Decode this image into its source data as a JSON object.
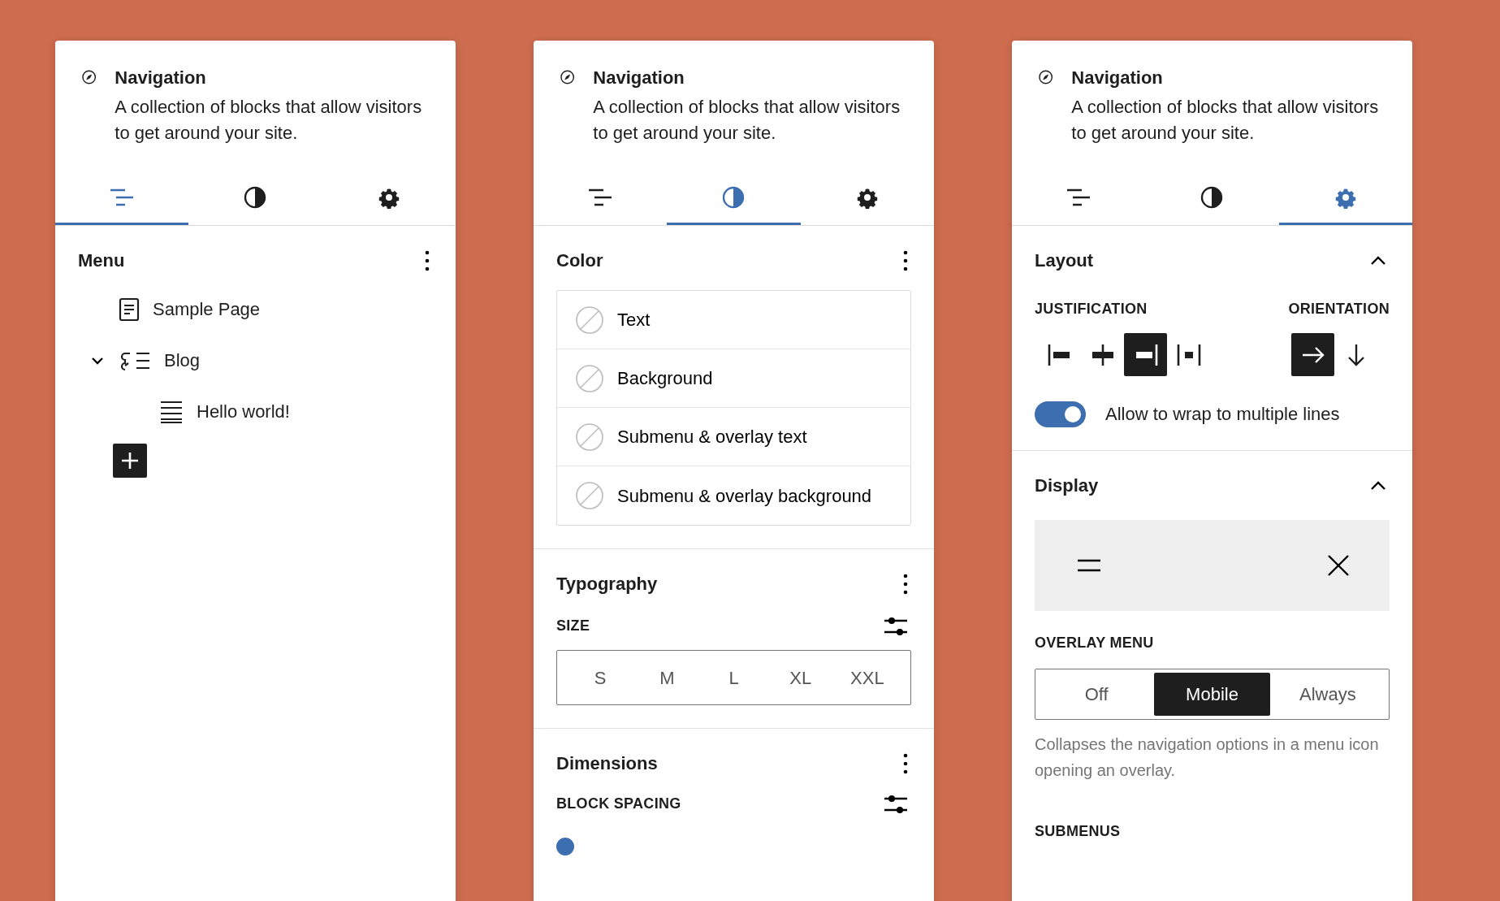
{
  "panels": [
    {
      "block": {
        "title": "Navigation",
        "description": "A collection of blocks that allow visitors to get around your site."
      },
      "tabs": [
        {
          "kind": "list",
          "selected": true
        },
        {
          "kind": "styles",
          "selected": false
        },
        {
          "kind": "settings",
          "selected": false
        }
      ],
      "sections": [
        {
          "kind": "menu",
          "title": "Menu",
          "items": [
            {
              "kind": "page",
              "label": "Sample Page"
            },
            {
              "kind": "submenu",
              "label": "Blog",
              "expanded": true,
              "children": [
                {
                  "kind": "post",
                  "label": "Hello world!"
                }
              ]
            }
          ]
        }
      ]
    },
    {
      "block": {
        "title": "Navigation",
        "description": "A collection of blocks that allow visitors to get around your site."
      },
      "tabs": [
        {
          "kind": "list",
          "selected": false
        },
        {
          "kind": "styles",
          "selected": true
        },
        {
          "kind": "settings",
          "selected": false
        }
      ],
      "sections": [
        {
          "kind": "color",
          "title": "Color",
          "items": [
            {
              "label": "Text"
            },
            {
              "label": "Background"
            },
            {
              "label": "Submenu & overlay text"
            },
            {
              "label": "Submenu & overlay background"
            }
          ]
        },
        {
          "kind": "typography",
          "title": "Typography",
          "size_label": "SIZE",
          "sizes": [
            {
              "label": "S",
              "selected": false
            },
            {
              "label": "M",
              "selected": false
            },
            {
              "label": "L",
              "selected": false
            },
            {
              "label": "XL",
              "selected": false
            },
            {
              "label": "XXL",
              "selected": false
            }
          ]
        },
        {
          "kind": "dimensions",
          "title": "Dimensions",
          "spacing_label": "BLOCK SPACING"
        }
      ]
    },
    {
      "block": {
        "title": "Navigation",
        "description": "A collection of blocks that allow visitors to get around your site."
      },
      "tabs": [
        {
          "kind": "list",
          "selected": false
        },
        {
          "kind": "styles",
          "selected": false
        },
        {
          "kind": "settings",
          "selected": true
        }
      ],
      "sections": [
        {
          "kind": "layout",
          "title": "Layout",
          "expanded": true,
          "justification_label": "JUSTIFICATION",
          "justification": [
            {
              "kind": "left",
              "selected": false
            },
            {
              "kind": "center",
              "selected": false
            },
            {
              "kind": "right",
              "selected": true
            },
            {
              "kind": "space-between",
              "selected": false
            }
          ],
          "orientation_label": "ORIENTATION",
          "orientation": [
            {
              "kind": "horizontal",
              "selected": true
            },
            {
              "kind": "vertical",
              "selected": false
            }
          ],
          "wrap": {
            "label": "Allow to wrap to multiple lines",
            "on": true
          }
        },
        {
          "kind": "display",
          "title": "Display",
          "expanded": true,
          "overlay_label": "OVERLAY MENU",
          "overlay_options": [
            {
              "label": "Off",
              "selected": false
            },
            {
              "label": "Mobile",
              "selected": true
            },
            {
              "label": "Always",
              "selected": false
            }
          ],
          "help": "Collapses the navigation options in a menu icon opening an overlay.",
          "submenus_label": "SUBMENUS"
        }
      ]
    }
  ]
}
